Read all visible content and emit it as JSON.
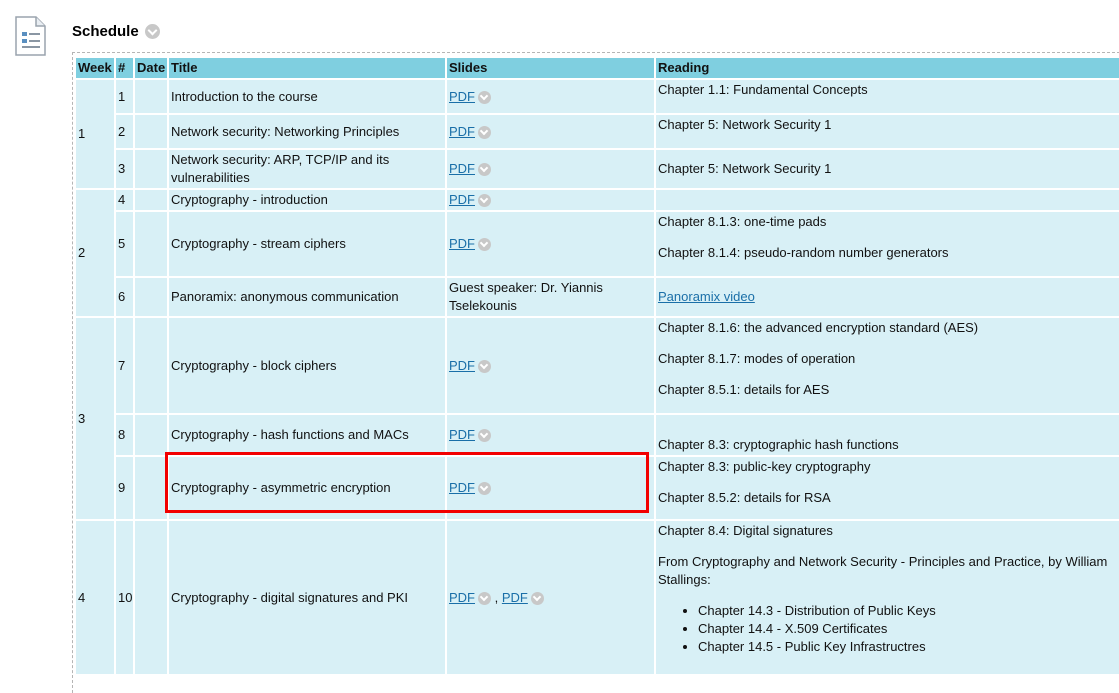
{
  "header": {
    "title": "Schedule"
  },
  "table": {
    "columns": [
      "Week",
      "#",
      "Date",
      "Title",
      "Slides",
      "Reading"
    ],
    "weeks": [
      "1",
      "2",
      "3",
      "4"
    ],
    "rows": [
      {
        "num": "1",
        "title": "Introduction to the course",
        "pdf": "PDF",
        "reading": [
          "Chapter 1.1: Fundamental Concepts"
        ]
      },
      {
        "num": "2",
        "title": "Network security: Networking Principles",
        "pdf": "PDF",
        "reading": [
          "Chapter 5: Network Security 1"
        ]
      },
      {
        "num": "3",
        "title": "Network security: ARP, TCP/IP and its vulnerabilities",
        "pdf": "PDF",
        "reading": [
          "Chapter 5: Network Security 1"
        ]
      },
      {
        "num": "4",
        "title": "Cryptography - introduction",
        "pdf": "PDF",
        "reading": []
      },
      {
        "num": "5",
        "title": "Cryptography - stream ciphers",
        "pdf": "PDF",
        "reading": [
          "Chapter 8.1.3: one-time pads",
          "Chapter 8.1.4: pseudo-random number generators"
        ]
      },
      {
        "num": "6",
        "title": "Panoramix: anonymous communication",
        "slides_text": "Guest speaker: Dr. Yiannis Tselekounis",
        "reading_link": "Panoramix video"
      },
      {
        "num": "7",
        "title": "Cryptography - block ciphers",
        "pdf": "PDF",
        "reading": [
          "Chapter 8.1.6: the advanced encryption standard (AES)",
          "Chapter 8.1.7: modes of operation",
          "Chapter 8.5.1: details for AES"
        ]
      },
      {
        "num": "8",
        "title": "Cryptography - hash functions and MACs",
        "pdf": "PDF",
        "reading": [
          "Chapter 8.3: cryptographic hash functions"
        ]
      },
      {
        "num": "9",
        "title": "Cryptography - asymmetric encryption",
        "pdf": "PDF",
        "reading": [
          "Chapter 8.3: public-key cryptography",
          "Chapter 8.5.2: details for RSA"
        ]
      },
      {
        "num": "10",
        "title": "Cryptography - digital signatures and PKI",
        "pdf": "PDF",
        "pdf2": "PDF",
        "reading": [
          "Chapter 8.4: Digital signatures",
          "From Cryptography and Network Security - Principles and Practice, by William Stallings:"
        ],
        "reading_list": [
          "Chapter 14.3 - Distribution of Public Keys",
          "Chapter 14.4 - X.509 Certificates",
          "Chapter 14.5 - Public Key Infrastructres"
        ]
      }
    ]
  },
  "colors": {
    "header_bg": "#7fcfe0",
    "cell_bg": "#d8f0f6",
    "highlight": "#f20000",
    "link": "#1a6fa8"
  },
  "icons": {
    "document": "document-icon",
    "chevron": "chevron-down-icon"
  }
}
